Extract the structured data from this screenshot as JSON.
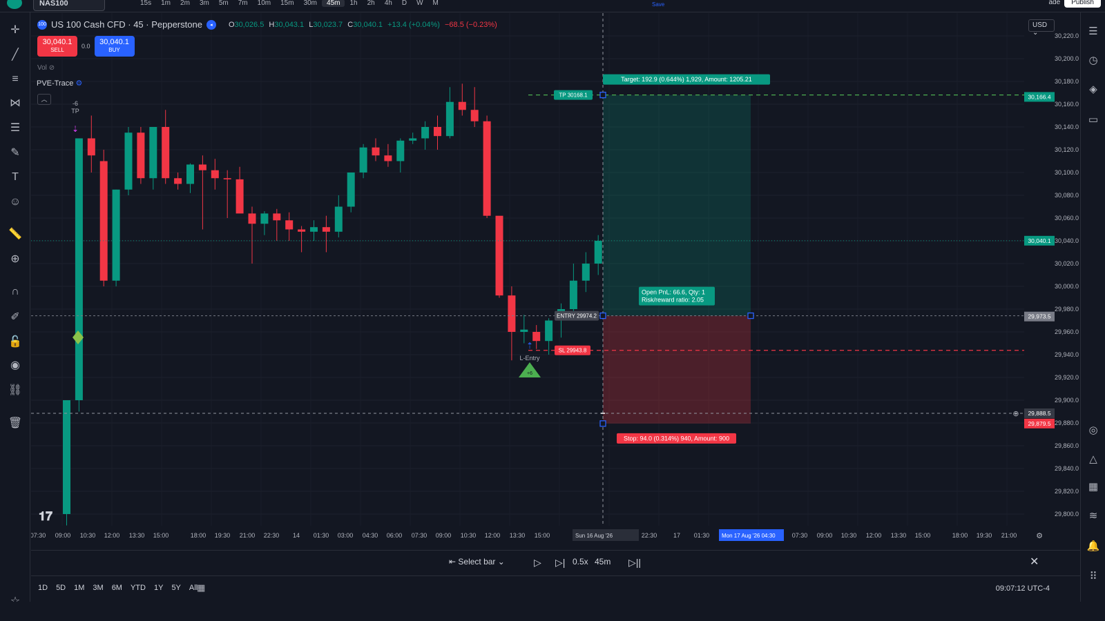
{
  "topbar": {
    "symbol": "NAS100",
    "timeframes": [
      "15s",
      "1m",
      "2m",
      "3m",
      "5m",
      "7m",
      "10m",
      "15m",
      "30m",
      "45m",
      "1h",
      "2h",
      "4h",
      "D",
      "W",
      "M"
    ],
    "active_timeframe": "45m",
    "save_label": "Save",
    "trade_label": "ade",
    "publish_label": "Publish"
  },
  "legend": {
    "title": "US 100 Cash CFD · 45 · Pepperstone",
    "badge": "100",
    "o_label": "O",
    "o": "30,026.5",
    "h_label": "H",
    "h": "30,043.1",
    "l_label": "L",
    "l": "30,023.7",
    "c_label": "C",
    "c": "30,040.1",
    "change": "+13.4 (+0.04%)",
    "change2": "−68.5 (−0.23%)"
  },
  "trade_buttons": {
    "sell_price": "30,040.1",
    "sell_label": "SELL",
    "spread": "0.0",
    "buy_price": "30,040.1",
    "buy_label": "BUY"
  },
  "vol_label": "Vol",
  "indicator_label": "PVE-Trace",
  "currency": "USD",
  "price_axis": {
    "ticks": [
      "30,220.0",
      "30,200.0",
      "30,180.0",
      "30,160.0",
      "30,140.0",
      "30,120.0",
      "30,100.0",
      "30,080.0",
      "30,060.0",
      "30,040.0",
      "30,020.0",
      "30,000.0",
      "29,980.0",
      "29,960.0",
      "29,940.0",
      "29,920.0",
      "29,900.0",
      "29,880.0",
      "29,860.0",
      "29,840.0",
      "29,820.0",
      "29,800.0"
    ],
    "tags": [
      {
        "label": "30,166.4",
        "value": 30166.4,
        "color": "#089981"
      },
      {
        "label": "30,040.1",
        "value": 30040.1,
        "color": "#089981"
      },
      {
        "label": "29,973.5",
        "value": 29973.5,
        "color": "#787b86"
      },
      {
        "label": "29,888.5",
        "value": 29888.5,
        "color": "#363a45"
      },
      {
        "label": "29,879.5",
        "value": 29879.5,
        "color": "#f23645"
      }
    ]
  },
  "time_axis": {
    "labels": [
      "07:30",
      "09:00",
      "10:30",
      "12:00",
      "13:30",
      "15:00",
      "18:00",
      "19:30",
      "21:00",
      "22:30",
      "14",
      "01:30",
      "03:00",
      "04:30",
      "06:00",
      "07:30",
      "09:00",
      "10:30",
      "12:00",
      "13:30",
      "15:00",
      "19:30",
      "22:30",
      "17",
      "01:30",
      "07:30",
      "09:00",
      "10:30",
      "12:00",
      "13:30",
      "15:00",
      "18:00",
      "19:30",
      "21:00"
    ],
    "cursor_label": "Sun 16 Aug '26",
    "range_label": "Mon 17 Aug '26   04:30"
  },
  "position_tool": {
    "target_label": "Target: 192.9 (0.644%) 1,929, Amount: 1205.21",
    "stop_label": "Stop: 94.0 (0.314%) 940, Amount: 900",
    "pnl_line1": "Open PnL: 66.6, Qty: 1",
    "pnl_line2": "Risk/reward ratio: 2.05",
    "tp_tag": "TP 30168.1",
    "entry_tag": "ENTRY 29974.2",
    "sl_tag": "SL 29943.8",
    "tp_price": 30168.1,
    "entry_price": 29974.2,
    "sl_price": 29943.8,
    "stop_price": 29879.5
  },
  "signals": {
    "tp_marker": "TP",
    "tp_marker_num": "-6",
    "entry_marker": "L-Entry",
    "entry_marker_num": "+6"
  },
  "replay": {
    "select_bar": "Select bar",
    "speed": "0.5x",
    "interval": "45m"
  },
  "bottom": {
    "ranges": [
      "1D",
      "5D",
      "1M",
      "3M",
      "6M",
      "YTD",
      "1Y",
      "5Y",
      "All"
    ],
    "clock": "09:07:12 UTC-4"
  },
  "colors": {
    "up": "#089981",
    "down": "#f23645",
    "accent": "#2962ff",
    "bg": "#131722"
  },
  "chart_data": {
    "type": "candlestick",
    "ylim": [
      29790,
      30230
    ],
    "candles": [
      {
        "o": 29800,
        "h": 29900,
        "l": 29790,
        "c": 29900,
        "t": "09:00"
      },
      {
        "o": 29900,
        "h": 30130,
        "l": 29890,
        "c": 30130
      },
      {
        "o": 30130,
        "h": 30150,
        "l": 30100,
        "c": 30115
      },
      {
        "o": 30110,
        "h": 30120,
        "l": 30000,
        "c": 30005
      },
      {
        "o": 30005,
        "h": 30085,
        "l": 30000,
        "c": 30085
      },
      {
        "o": 30085,
        "h": 30140,
        "l": 30080,
        "c": 30135
      },
      {
        "o": 30135,
        "h": 30140,
        "l": 30090,
        "c": 30095
      },
      {
        "o": 30095,
        "h": 30140,
        "l": 30085,
        "c": 30140
      },
      {
        "o": 30140,
        "h": 30155,
        "l": 30090,
        "c": 30095
      },
      {
        "o": 30095,
        "h": 30100,
        "l": 30085,
        "c": 30090
      },
      {
        "o": 30090,
        "h": 30108,
        "l": 30082,
        "c": 30107
      },
      {
        "o": 30107,
        "h": 30115,
        "l": 30050,
        "c": 30102
      },
      {
        "o": 30102,
        "h": 30112,
        "l": 30085,
        "c": 30095
      },
      {
        "o": 30095,
        "h": 30102,
        "l": 30060,
        "c": 30094
      },
      {
        "o": 30094,
        "h": 30105,
        "l": 30065,
        "c": 30064
      },
      {
        "o": 30064,
        "h": 30070,
        "l": 30020,
        "c": 30055
      },
      {
        "o": 30055,
        "h": 30066,
        "l": 30045,
        "c": 30064
      },
      {
        "o": 30064,
        "h": 30068,
        "l": 30040,
        "c": 30058
      },
      {
        "o": 30058,
        "h": 30065,
        "l": 30040,
        "c": 30050
      },
      {
        "o": 30050,
        "h": 30053,
        "l": 30030,
        "c": 30048
      },
      {
        "o": 30048,
        "h": 30058,
        "l": 30040,
        "c": 30052
      },
      {
        "o": 30052,
        "h": 30062,
        "l": 30030,
        "c": 30048
      },
      {
        "o": 30048,
        "h": 30080,
        "l": 30043,
        "c": 30070
      },
      {
        "o": 30070,
        "h": 30100,
        "l": 30065,
        "c": 30100
      },
      {
        "o": 30100,
        "h": 30125,
        "l": 30095,
        "c": 30122
      },
      {
        "o": 30122,
        "h": 30130,
        "l": 30110,
        "c": 30115
      },
      {
        "o": 30115,
        "h": 30125,
        "l": 30105,
        "c": 30110
      },
      {
        "o": 30110,
        "h": 30130,
        "l": 30100,
        "c": 30128
      },
      {
        "o": 30128,
        "h": 30135,
        "l": 30125,
        "c": 30130
      },
      {
        "o": 30130,
        "h": 30145,
        "l": 30120,
        "c": 30140
      },
      {
        "o": 30140,
        "h": 30150,
        "l": 30120,
        "c": 30132
      },
      {
        "o": 30132,
        "h": 30175,
        "l": 30130,
        "c": 30162
      },
      {
        "o": 30162,
        "h": 30178,
        "l": 30150,
        "c": 30155
      },
      {
        "o": 30155,
        "h": 30175,
        "l": 30140,
        "c": 30145
      },
      {
        "o": 30145,
        "h": 30150,
        "l": 30060,
        "c": 30062
      },
      {
        "o": 30062,
        "h": 30060,
        "l": 29990,
        "c": 29992
      },
      {
        "o": 29992,
        "h": 30000,
        "l": 29935,
        "c": 29960
      },
      {
        "o": 29960,
        "h": 29975,
        "l": 29950,
        "c": 29962
      },
      {
        "o": 29960,
        "h": 29966,
        "l": 29945,
        "c": 29952
      },
      {
        "o": 29952,
        "h": 29972,
        "l": 29940,
        "c": 29970
      },
      {
        "o": 29970,
        "h": 29985,
        "l": 29955,
        "c": 29980
      },
      {
        "o": 29980,
        "h": 30020,
        "l": 29975,
        "c": 30005
      },
      {
        "o": 30005,
        "h": 30030,
        "l": 29995,
        "c": 30020
      },
      {
        "o": 30020,
        "h": 30045,
        "l": 30010,
        "c": 30040
      }
    ]
  }
}
